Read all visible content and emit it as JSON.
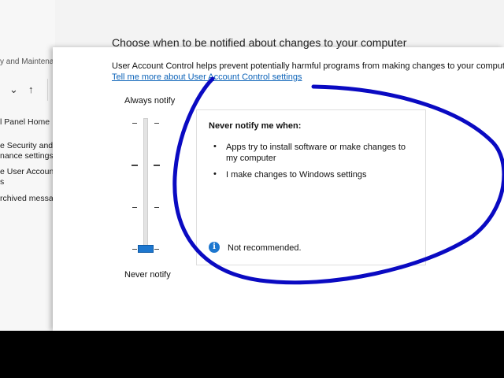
{
  "page": {
    "title": "Choose when to be notified about changes to your computer",
    "description": "User Account Control helps prevent potentially harmful programs from making changes to your computer.",
    "learn_more_link": "Tell me more about User Account Control settings"
  },
  "left_nav": {
    "breadcrumb": "y and Maintena",
    "links": [
      "l Panel Home",
      "e Security and",
      "nance settings",
      "e User Account C",
      "s",
      "rchived message"
    ]
  },
  "slider": {
    "top_label": "Always notify",
    "bottom_label": "Never notify",
    "current_level": "Never notify"
  },
  "info_panel": {
    "heading": "Never notify me when:",
    "bullet_glyph": "•",
    "bullets": [
      "Apps try to install software or make changes to my computer",
      "I make changes to Windows settings"
    ],
    "info_glyph": "i",
    "recommendation": "Not recommended."
  },
  "colors": {
    "accent": "#1d77cf",
    "link": "#0b62b8",
    "annotation_stroke": "#0a0ac2",
    "letterbox": "#000000"
  }
}
